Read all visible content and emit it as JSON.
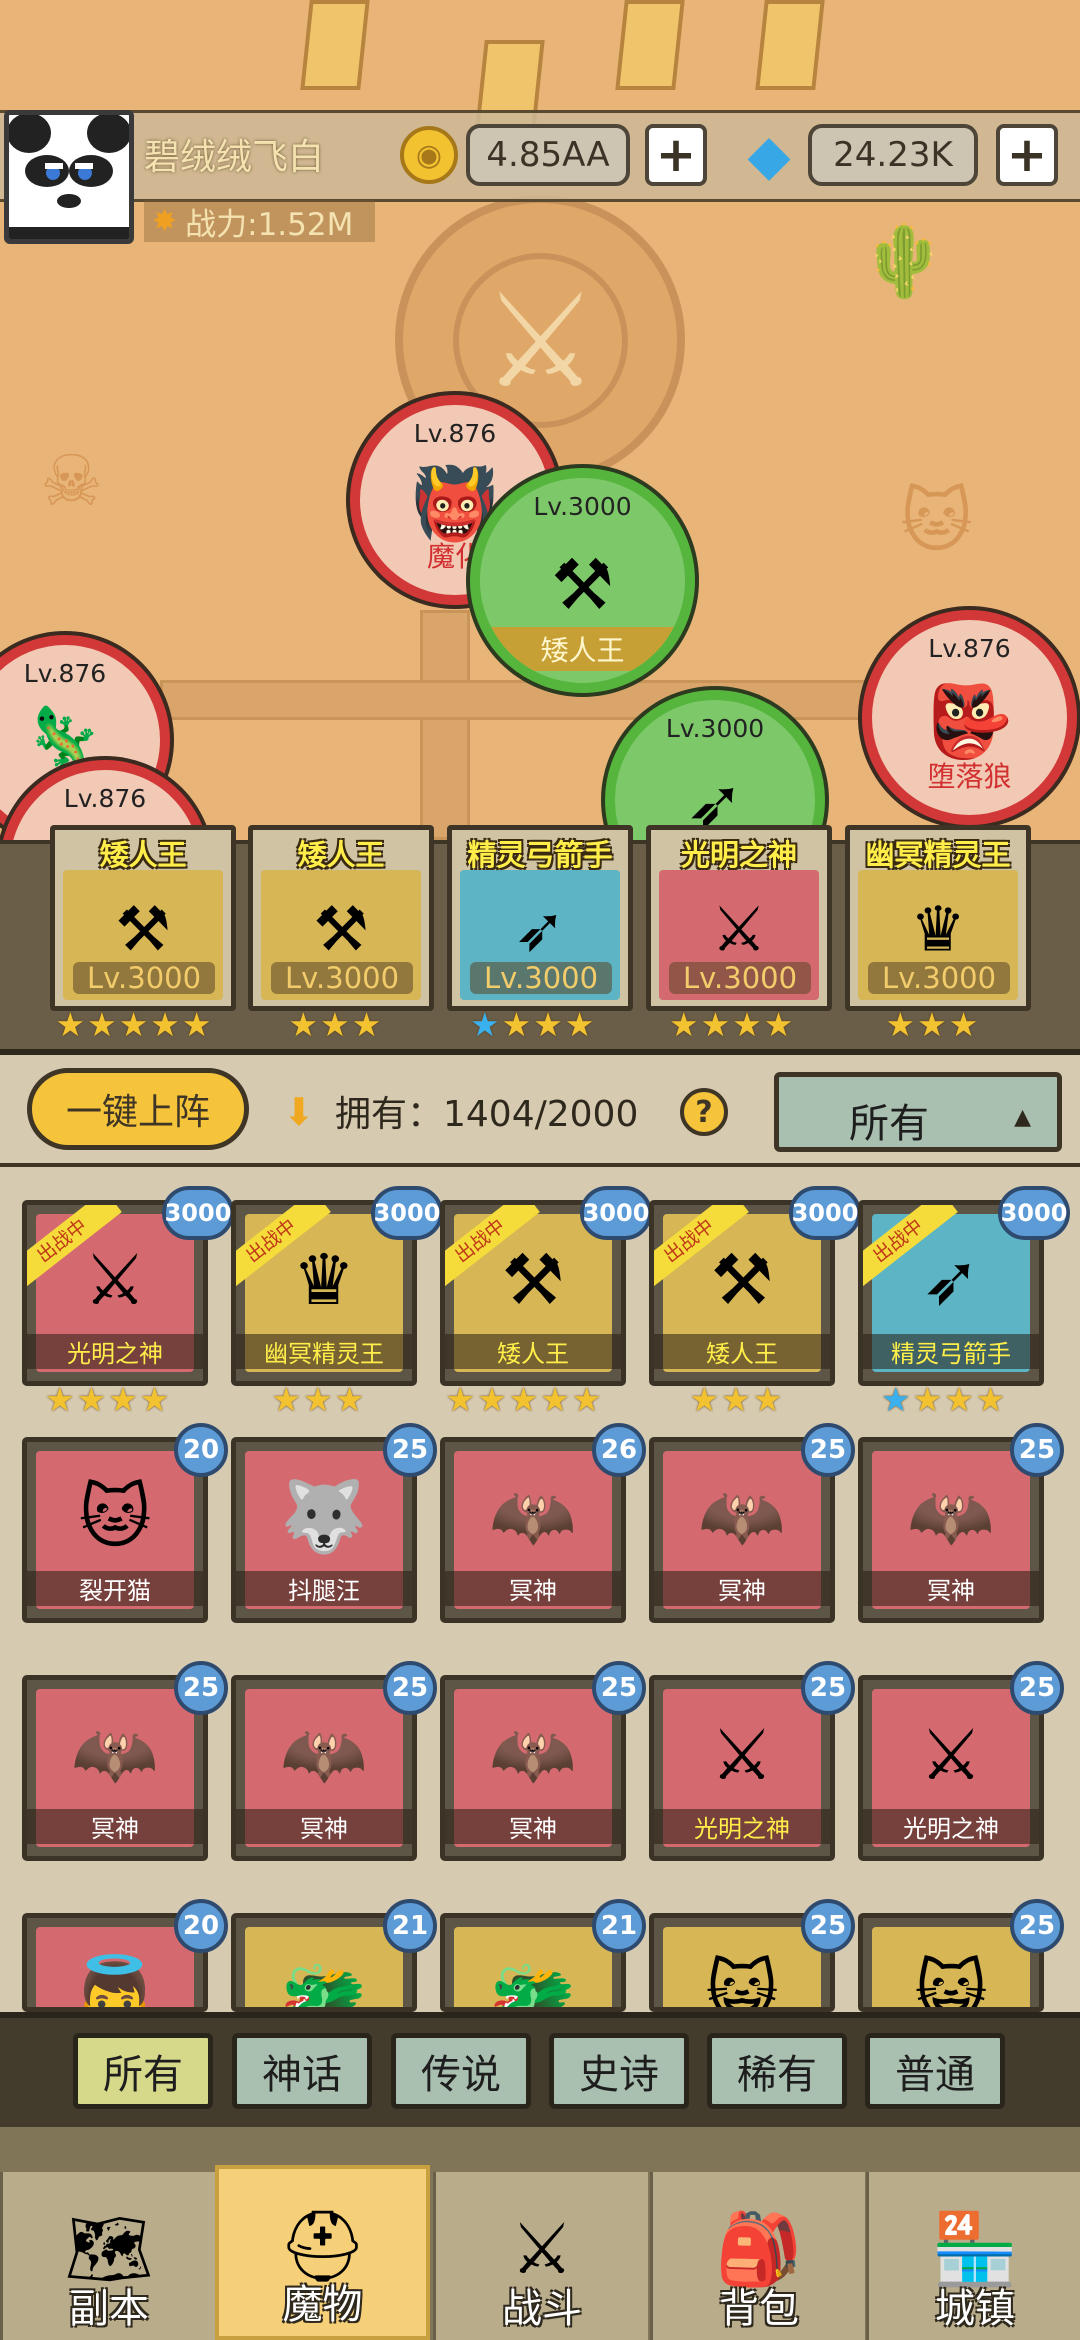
{
  "player": {
    "name": "碧绒绒飞白",
    "power": "战力:1.52M",
    "gold": "4.85AA",
    "gems": "24.23K"
  },
  "map_units": [
    {
      "lv": "Lv.876",
      "name": "魔化",
      "style": "red"
    },
    {
      "lv": "Lv.3000",
      "name": "矮人王",
      "style": "green"
    },
    {
      "lv": "Lv.876",
      "name": "",
      "style": "red"
    },
    {
      "lv": "Lv.876",
      "name": "",
      "style": "red"
    },
    {
      "lv": "Lv.3000",
      "name": "",
      "style": "green"
    },
    {
      "lv": "Lv.876",
      "name": "堕落狼",
      "style": "red"
    }
  ],
  "lineup": [
    {
      "name": "矮人王",
      "level": "Lv.3000",
      "stars": 5,
      "blue_stars": 0,
      "bg": "gold"
    },
    {
      "name": "矮人王",
      "level": "Lv.3000",
      "stars": 3,
      "blue_stars": 0,
      "bg": "gold"
    },
    {
      "name": "精灵弓箭手",
      "level": "Lv.3000",
      "stars": 4,
      "blue_stars": 1,
      "bg": "teal"
    },
    {
      "name": "光明之神",
      "level": "Lv.3000",
      "stars": 4,
      "blue_stars": 0,
      "bg": "red"
    },
    {
      "name": "幽冥精灵王",
      "level": "Lv.3000",
      "stars": 3,
      "blue_stars": 0,
      "bg": "gold"
    }
  ],
  "collection": {
    "deploy_label": "一键上阵",
    "own_label": "拥有：1404/2000",
    "filter_selected": "所有",
    "deployed_tag": "出战中"
  },
  "cards": [
    {
      "name": "光明之神",
      "badge": "3000",
      "bg": "red",
      "deployed": true,
      "stars": 4,
      "blue_stars": 0,
      "fig": "⚔"
    },
    {
      "name": "幽冥精灵王",
      "badge": "3000",
      "bg": "gold",
      "deployed": true,
      "stars": 3,
      "blue_stars": 0,
      "fig": "♛"
    },
    {
      "name": "矮人王",
      "badge": "3000",
      "bg": "gold",
      "deployed": true,
      "stars": 5,
      "blue_stars": 0,
      "fig": "⚒"
    },
    {
      "name": "矮人王",
      "badge": "3000",
      "bg": "gold",
      "deployed": true,
      "stars": 3,
      "blue_stars": 0,
      "fig": "⚒"
    },
    {
      "name": "精灵弓箭手",
      "badge": "3000",
      "bg": "teal",
      "deployed": true,
      "stars": 4,
      "blue_stars": 1,
      "fig": "➶"
    },
    {
      "name": "裂开猫",
      "badge": "20",
      "bg": "red",
      "fig": "🐱"
    },
    {
      "name": "抖腿汪",
      "badge": "25",
      "bg": "red",
      "fig": "🐺"
    },
    {
      "name": "冥神",
      "badge": "26",
      "bg": "red",
      "fig": "🦇"
    },
    {
      "name": "冥神",
      "badge": "25",
      "bg": "red",
      "fig": "🦇"
    },
    {
      "name": "冥神",
      "badge": "25",
      "bg": "red",
      "fig": "🦇"
    },
    {
      "name": "冥神",
      "badge": "25",
      "bg": "red",
      "fig": "🦇"
    },
    {
      "name": "冥神",
      "badge": "25",
      "bg": "red",
      "fig": "🦇"
    },
    {
      "name": "冥神",
      "badge": "25",
      "bg": "red",
      "fig": "🦇"
    },
    {
      "name": "光明之神",
      "badge": "25",
      "bg": "red",
      "gold_name": true,
      "fig": "⚔"
    },
    {
      "name": "光明之神",
      "badge": "25",
      "bg": "red",
      "fig": "⚔"
    },
    {
      "name": "",
      "badge": "20",
      "bg": "red",
      "fig": "👼"
    },
    {
      "name": "",
      "badge": "21",
      "bg": "gold",
      "fig": "🐲"
    },
    {
      "name": "",
      "badge": "21",
      "bg": "gold",
      "fig": "🐲"
    },
    {
      "name": "",
      "badge": "25",
      "bg": "gold",
      "fig": "😺"
    },
    {
      "name": "",
      "badge": "25",
      "bg": "gold",
      "fig": "😺"
    }
  ],
  "rarity_tabs": [
    "所有",
    "神话",
    "传说",
    "史诗",
    "稀有",
    "普通"
  ],
  "nav": [
    {
      "label": "副本",
      "icon": "map-icon",
      "glyph": "🗺"
    },
    {
      "label": "魔物",
      "icon": "monster-helmet-icon",
      "glyph": "⛑"
    },
    {
      "label": "战斗",
      "icon": "crossed-swords-icon",
      "glyph": "⚔"
    },
    {
      "label": "背包",
      "icon": "backpack-icon",
      "glyph": "🎒"
    },
    {
      "label": "城镇",
      "icon": "town-shop-icon",
      "glyph": "🏪"
    }
  ]
}
